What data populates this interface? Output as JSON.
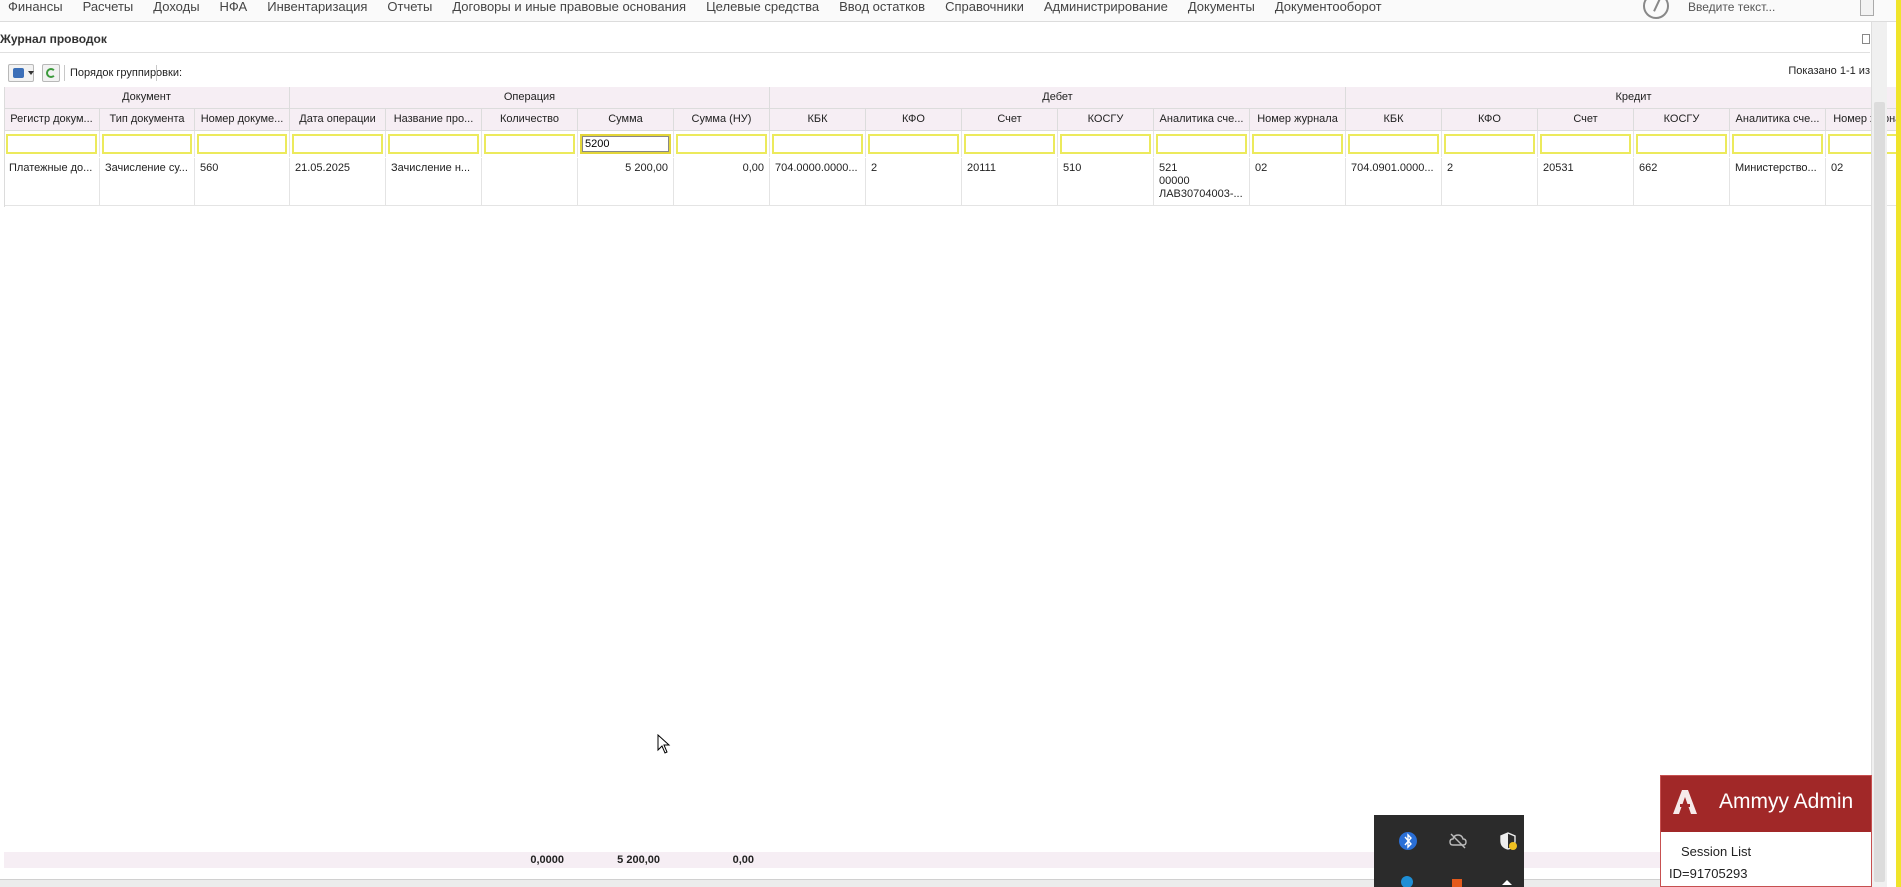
{
  "menu": {
    "items": [
      "Финансы",
      "Расчеты",
      "Доходы",
      "НФА",
      "Инвентаризация",
      "Отчеты",
      "Договоры и иные правовые основания",
      "Целевые средства",
      "Ввод остатков",
      "Справочники",
      "Администрирование",
      "Документы",
      "Документооборот"
    ],
    "search_placeholder": "Введите текст..."
  },
  "panel": {
    "title": "Журнал проводок"
  },
  "toolbar": {
    "grouping_label": "Порядок группировки:",
    "shown_label": "Показано 1-1 из"
  },
  "grid": {
    "bands": [
      "Документ",
      "Операция",
      "Дебет",
      "Кредит"
    ],
    "columns": [
      "Регистр докум...",
      "Тип документа",
      "Номер докуме...",
      "Дата операции",
      "Название про...",
      "Количество",
      "Сумма",
      "Сумма (НУ)",
      "КБК",
      "КФО",
      "Счет",
      "КОСГУ",
      "Аналитика сче...",
      "Номер журнала",
      "КБК",
      "КФО",
      "Счет",
      "КОСГУ",
      "Аналитика сче...",
      "Номер журнала"
    ],
    "filter_values": [
      "",
      "",
      "",
      "",
      "",
      "",
      "5200",
      "",
      "",
      "",
      "",
      "",
      "",
      "",
      "",
      "",
      "",
      "",
      "",
      ""
    ],
    "rows": [
      {
        "cells": [
          "Платежные до...",
          "Зачисление су...",
          "560",
          "21.05.2025",
          "Зачисление н...",
          "",
          "5 200,00",
          "0,00",
          "704.0000.0000...",
          "2",
          "20111",
          "510",
          "",
          "02",
          "704.0901.0000...",
          "2",
          "20531",
          "662",
          "Министерство...",
          "02"
        ],
        "analytics_lines": [
          "521",
          "00000",
          "ЛАВ30704003-..."
        ]
      }
    ]
  },
  "totals": {
    "quantity": "0,0000",
    "sum": "5 200,00",
    "sum_nu": "0,00"
  },
  "ammyy": {
    "title": "Ammyy Admin",
    "session_list": "Session List",
    "id_text": "ID=91705293"
  },
  "colors": {
    "band_bg": "#f6eef4",
    "filter_border": "#ecea5c",
    "ammyy_red": "#a12828"
  }
}
